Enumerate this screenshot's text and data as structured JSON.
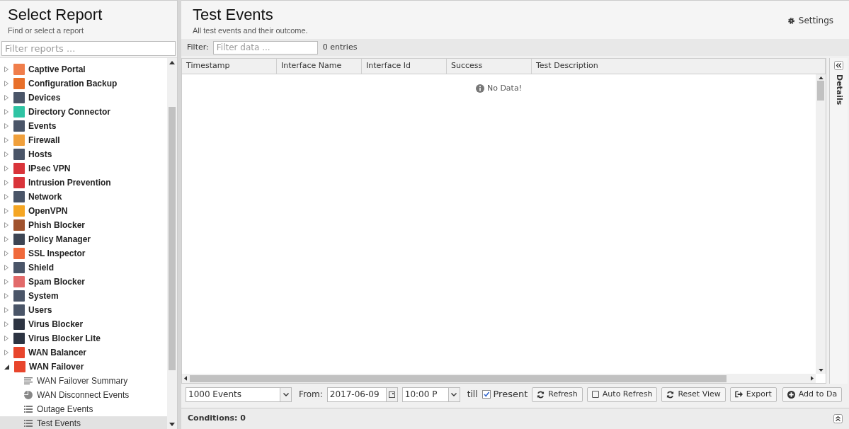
{
  "sidebar": {
    "title": "Select Report",
    "subtitle": "Find or select a report",
    "filter": {
      "placeholder": "Filter reports ..."
    },
    "items": [
      {
        "label": "Captive Portal",
        "color": "#f07e4b",
        "expanded": false
      },
      {
        "label": "Configuration Backup",
        "color": "#e8702a",
        "expanded": false
      },
      {
        "label": "Devices",
        "color": "#4a5568",
        "expanded": false
      },
      {
        "label": "Directory Connector",
        "color": "#2fc4a4",
        "expanded": false
      },
      {
        "label": "Events",
        "color": "#4a5568",
        "expanded": false
      },
      {
        "label": "Firewall",
        "color": "#f0a03c",
        "expanded": false
      },
      {
        "label": "Hosts",
        "color": "#4a5568",
        "expanded": false
      },
      {
        "label": "IPsec VPN",
        "color": "#d9343a",
        "expanded": false
      },
      {
        "label": "Intrusion Prevention",
        "color": "#d9343a",
        "expanded": false
      },
      {
        "label": "Network",
        "color": "#4a5568",
        "expanded": false
      },
      {
        "label": "OpenVPN",
        "color": "#f5a623",
        "expanded": false
      },
      {
        "label": "Phish Blocker",
        "color": "#a0522d",
        "expanded": false
      },
      {
        "label": "Policy Manager",
        "color": "#3d4553",
        "expanded": false
      },
      {
        "label": "SSL Inspector",
        "color": "#f06a3c",
        "expanded": false
      },
      {
        "label": "Shield",
        "color": "#4a5568",
        "expanded": false
      },
      {
        "label": "Spam Blocker",
        "color": "#e26a6a",
        "expanded": false
      },
      {
        "label": "System",
        "color": "#4a5568",
        "expanded": false
      },
      {
        "label": "Users",
        "color": "#4a5568",
        "expanded": false
      },
      {
        "label": "Virus Blocker",
        "color": "#2d3442",
        "expanded": false
      },
      {
        "label": "Virus Blocker Lite",
        "color": "#2d3442",
        "expanded": false
      },
      {
        "label": "WAN Balancer",
        "color": "#e8452c",
        "expanded": false
      },
      {
        "label": "WAN Failover",
        "color": "#e8452c",
        "expanded": true,
        "children": [
          {
            "label": "WAN Failover Summary",
            "kind": "text",
            "selected": false
          },
          {
            "label": "WAN Disconnect Events",
            "kind": "pie",
            "selected": false
          },
          {
            "label": "Outage Events",
            "kind": "list",
            "selected": false
          },
          {
            "label": "Test Events",
            "kind": "list",
            "selected": true
          }
        ]
      }
    ]
  },
  "report": {
    "title": "Test Events",
    "subtitle": "All test events and their outcome.",
    "settings": "Settings",
    "filter_label": "Filter:",
    "filter": {
      "placeholder": "Filter data ..."
    },
    "entries": "0 entries",
    "details": "Details",
    "columns": [
      "Timestamp",
      "Interface Name",
      "Interface Id",
      "Success",
      "Test Description"
    ],
    "empty": "No Data!",
    "toolbar": {
      "limit": "1000 Events",
      "from_label": "From:",
      "date": "2017-06-09",
      "time": "10:00 P",
      "till": "till",
      "present": {
        "label": "Present",
        "checked": true
      },
      "refresh": "Refresh",
      "auto_refresh": {
        "label": "Auto Refresh",
        "checked": false
      },
      "reset": "Reset View",
      "export": "Export",
      "add": "Add to Da"
    },
    "conditions": "Conditions: 0"
  }
}
